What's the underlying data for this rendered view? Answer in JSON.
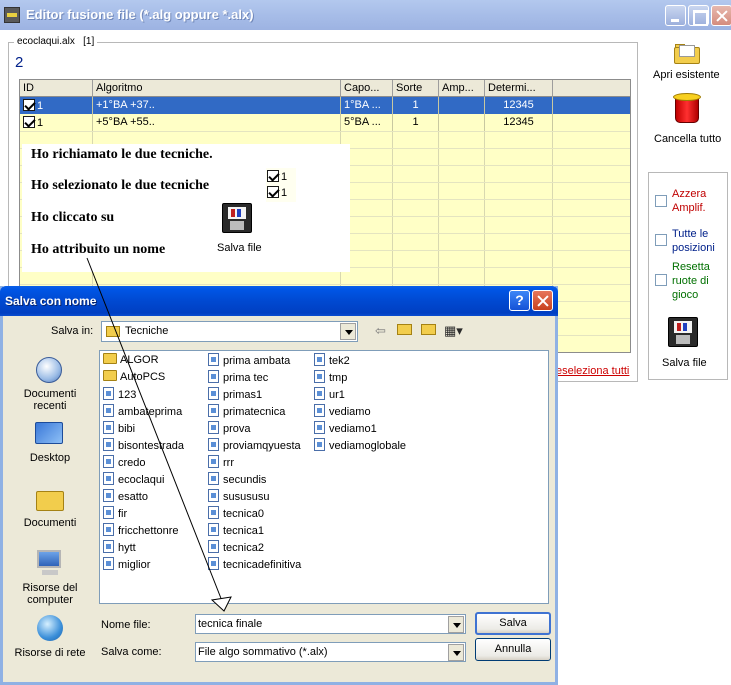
{
  "main_window": {
    "title": "Editor fusione file (*.alg oppure *.alx)",
    "file_name": "ecoclaqui.alx",
    "file_index": "[1]",
    "count": "2"
  },
  "grid": {
    "columns": [
      "ID",
      "Algoritmo",
      "Capo...",
      "Sorte",
      "Amp...",
      "Determi..."
    ],
    "rows": [
      {
        "id": "1",
        "algoritmo": "+1°BA +37..",
        "capo": "1°BA ...",
        "sorte": "1",
        "amp": "",
        "determi": "12345",
        "selected": true
      },
      {
        "id": "1",
        "algoritmo": "+5°BA +55..",
        "capo": "5°BA ...",
        "sorte": "1",
        "amp": "",
        "determi": "12345",
        "selected": false
      }
    ]
  },
  "annotation": {
    "line1": "Ho richiamato le due tecniche.",
    "line2": "Ho selezionato le due tecniche",
    "line3": "Ho cliccato su",
    "line4": "Ho attribuito un nome",
    "mini_check_1": "1",
    "mini_check_2": "1",
    "salva_file_label": "Salva file"
  },
  "right_toolbar": {
    "apri_label": "Apri esistente",
    "cancella_label": "Cancella tutto",
    "azzera_label_1": "Azzera",
    "azzera_label_2": "Amplif.",
    "tutte_label_1": "Tutte le",
    "tutte_label_2": "posizioni",
    "resetta_label_1": "Resetta",
    "resetta_label_2": "ruote di",
    "resetta_label_3": "gioco",
    "salva_file_label": "Salva file",
    "deseleziona_label": "eseleziona tutti"
  },
  "dialog": {
    "title": "Salva con nome",
    "help": "?",
    "salva_in_label": "Salva in:",
    "salva_in_value": "Tecniche",
    "places": [
      {
        "line1": "Documenti",
        "line2": "recenti"
      },
      {
        "line1": "Desktop",
        "line2": ""
      },
      {
        "line1": "Documenti",
        "line2": ""
      },
      {
        "line1": "Risorse del",
        "line2": "computer"
      },
      {
        "line1": "Risorse di rete",
        "line2": ""
      }
    ],
    "files_col1": [
      {
        "name": "ALGOR",
        "type": "folder"
      },
      {
        "name": "AutoPCS",
        "type": "folder"
      },
      {
        "name": "123",
        "type": "file"
      },
      {
        "name": "ambateprima",
        "type": "file"
      },
      {
        "name": "bibi",
        "type": "file"
      },
      {
        "name": "bisontestrada",
        "type": "file"
      },
      {
        "name": "credo",
        "type": "file"
      },
      {
        "name": "ecoclaqui",
        "type": "file"
      },
      {
        "name": "esatto",
        "type": "file"
      },
      {
        "name": "fir",
        "type": "file"
      },
      {
        "name": "fricchettonre",
        "type": "file"
      },
      {
        "name": "hytt",
        "type": "file"
      },
      {
        "name": "miglior",
        "type": "file"
      }
    ],
    "files_col2": [
      {
        "name": "prima ambata",
        "type": "file"
      },
      {
        "name": "prima tec",
        "type": "file"
      },
      {
        "name": "primas1",
        "type": "file"
      },
      {
        "name": "primatecnica",
        "type": "file"
      },
      {
        "name": "prova",
        "type": "file"
      },
      {
        "name": "proviamqyuesta",
        "type": "file"
      },
      {
        "name": "rrr",
        "type": "file"
      },
      {
        "name": "secundis",
        "type": "file"
      },
      {
        "name": "susususu",
        "type": "file"
      },
      {
        "name": "tecnica0",
        "type": "file"
      },
      {
        "name": "tecnica1",
        "type": "file"
      },
      {
        "name": "tecnica2",
        "type": "file"
      },
      {
        "name": "tecnicadefinitiva",
        "type": "file"
      }
    ],
    "files_col3": [
      {
        "name": "tek2",
        "type": "file"
      },
      {
        "name": "tmp",
        "type": "file"
      },
      {
        "name": "ur1",
        "type": "file"
      },
      {
        "name": "vediamo",
        "type": "file"
      },
      {
        "name": "vediamo1",
        "type": "file"
      },
      {
        "name": "vediamoglobale",
        "type": "file"
      }
    ],
    "nome_file_label": "Nome file:",
    "nome_file_value": "tecnica finale",
    "salva_come_label": "Salva come:",
    "salva_come_value": "File algo sommativo (*.alx)",
    "salva_button": "Salva",
    "annulla_button": "Annulla"
  }
}
